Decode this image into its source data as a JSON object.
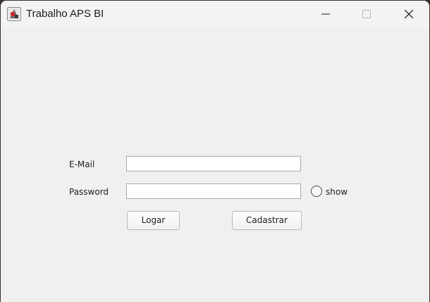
{
  "window": {
    "title": "Trabalho APS BI",
    "app_icon": "java-app-icon",
    "controls": {
      "minimize_icon": "minimize-icon",
      "maximize_icon": "maximize-icon",
      "close_icon": "close-icon"
    }
  },
  "login_form": {
    "email_label": "E-Mail",
    "email_value": "",
    "password_label": "Password",
    "password_value": "",
    "show_label": "show",
    "show_checked": false,
    "login_button": "Logar",
    "register_button": "Cadastrar"
  }
}
